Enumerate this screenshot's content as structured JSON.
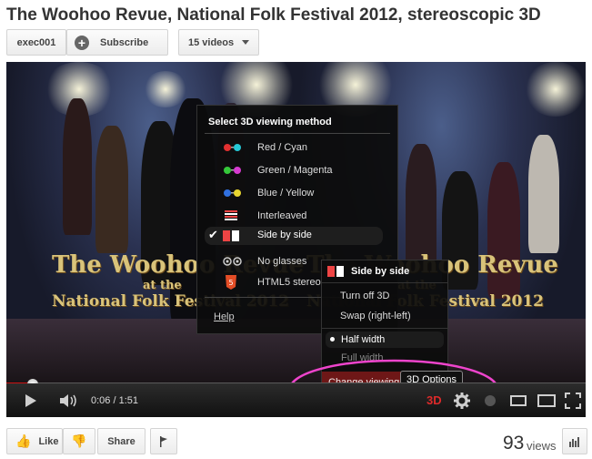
{
  "title": "The Woohoo Revue, National Folk Festival 2012, stereoscopic 3D",
  "channel": {
    "name": "exec001",
    "subscribe_label": "Subscribe",
    "videos_label": "15 videos"
  },
  "banner": {
    "line1": "The Woohoo Revue",
    "line2": "at the",
    "line3": "National Folk Festival 2012"
  },
  "method_menu": {
    "heading": "Select 3D viewing method",
    "items": [
      {
        "label": "Red / Cyan",
        "icon": "red-cyan-glasses-icon",
        "colors": [
          "#e23030",
          "#25c8d6"
        ]
      },
      {
        "label": "Green / Magenta",
        "icon": "green-magenta-glasses-icon",
        "colors": [
          "#35c83a",
          "#d63bd0"
        ]
      },
      {
        "label": "Blue / Yellow",
        "icon": "blue-yellow-glasses-icon",
        "colors": [
          "#3070e0",
          "#e8d630"
        ]
      },
      {
        "label": "Interleaved",
        "icon": "interleaved-icon"
      },
      {
        "label": "Side by side",
        "icon": "side-by-side-icon",
        "selected": true
      },
      {
        "label": "No glasses",
        "icon": "no-glasses-icon"
      },
      {
        "label": "HTML5 stereo",
        "icon": "html5-icon"
      }
    ],
    "help_label": "Help"
  },
  "sbs_menu": {
    "heading": "Side by side",
    "items": [
      "Turn off 3D",
      "Swap (right-left)"
    ],
    "width_options": [
      {
        "label": "Half width",
        "selected": true
      },
      {
        "label": "Full width",
        "selected": false
      }
    ],
    "change_label": "Change viewing m"
  },
  "tooltip": "3D Options",
  "player": {
    "time": "0:06 / 1:51",
    "three_d_label": "3D",
    "progress": 0.045
  },
  "actions": {
    "like_label": "Like",
    "share_label": "Share"
  },
  "views": {
    "count": "93",
    "label": "views"
  },
  "colors": {
    "accent_red": "#cc1111",
    "highlight_pink": "#ee44cc",
    "menu_bg": "#0c0c0c"
  }
}
